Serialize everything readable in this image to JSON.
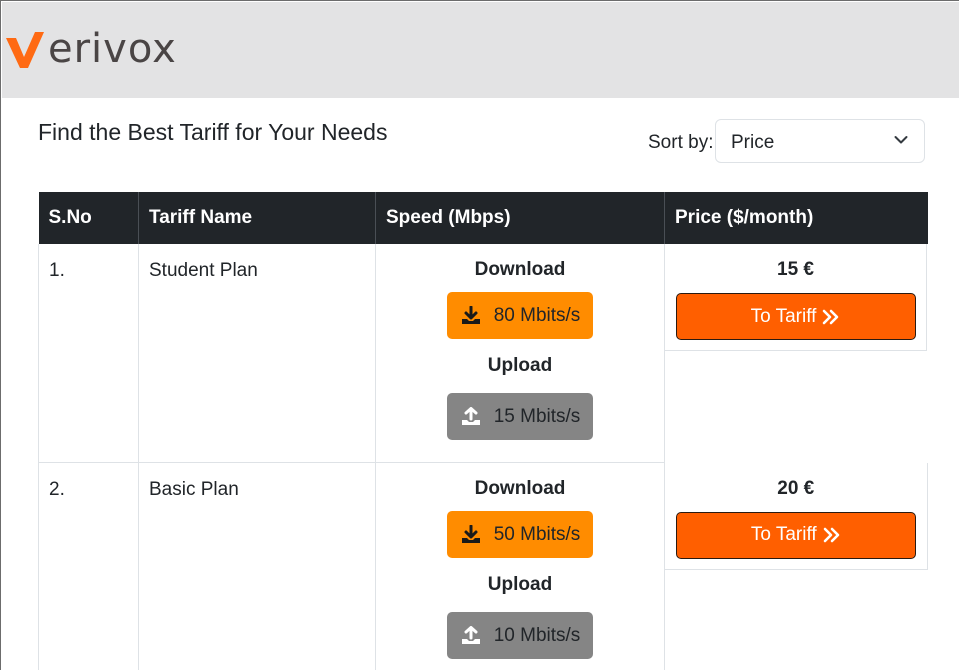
{
  "brand": {
    "logo_text": "erivox",
    "logo_accent_color": "#ff6a13"
  },
  "page": {
    "title": "Find the Best Tariff for Your Needs"
  },
  "sort": {
    "label": "Sort by:",
    "selected": "Price",
    "icon": "chevron-down-icon"
  },
  "table": {
    "headers": [
      "S.No",
      "Tariff Name",
      "Speed (Mbps)",
      "Price ($/month)"
    ],
    "rows": [
      {
        "sno": "1.",
        "name": "Student Plan",
        "download_label": "Download",
        "download": "80 Mbits/s",
        "upload_label": "Upload",
        "upload": "15 Mbits/s",
        "price": "15 €",
        "button": "To Tariff"
      },
      {
        "sno": "2.",
        "name": "Basic Plan",
        "download_label": "Download",
        "download": "50 Mbits/s",
        "upload_label": "Upload",
        "upload": "10 Mbits/s",
        "price": "20 €",
        "button": "To Tariff"
      }
    ]
  },
  "colors": {
    "header_bg": "#212529",
    "download_badge": "#ff8c00",
    "upload_badge": "#858585",
    "cta_button": "#ff5f00"
  },
  "icons": {
    "download": "download-icon",
    "upload": "upload-icon",
    "cta": "double-chevron-right-icon"
  }
}
